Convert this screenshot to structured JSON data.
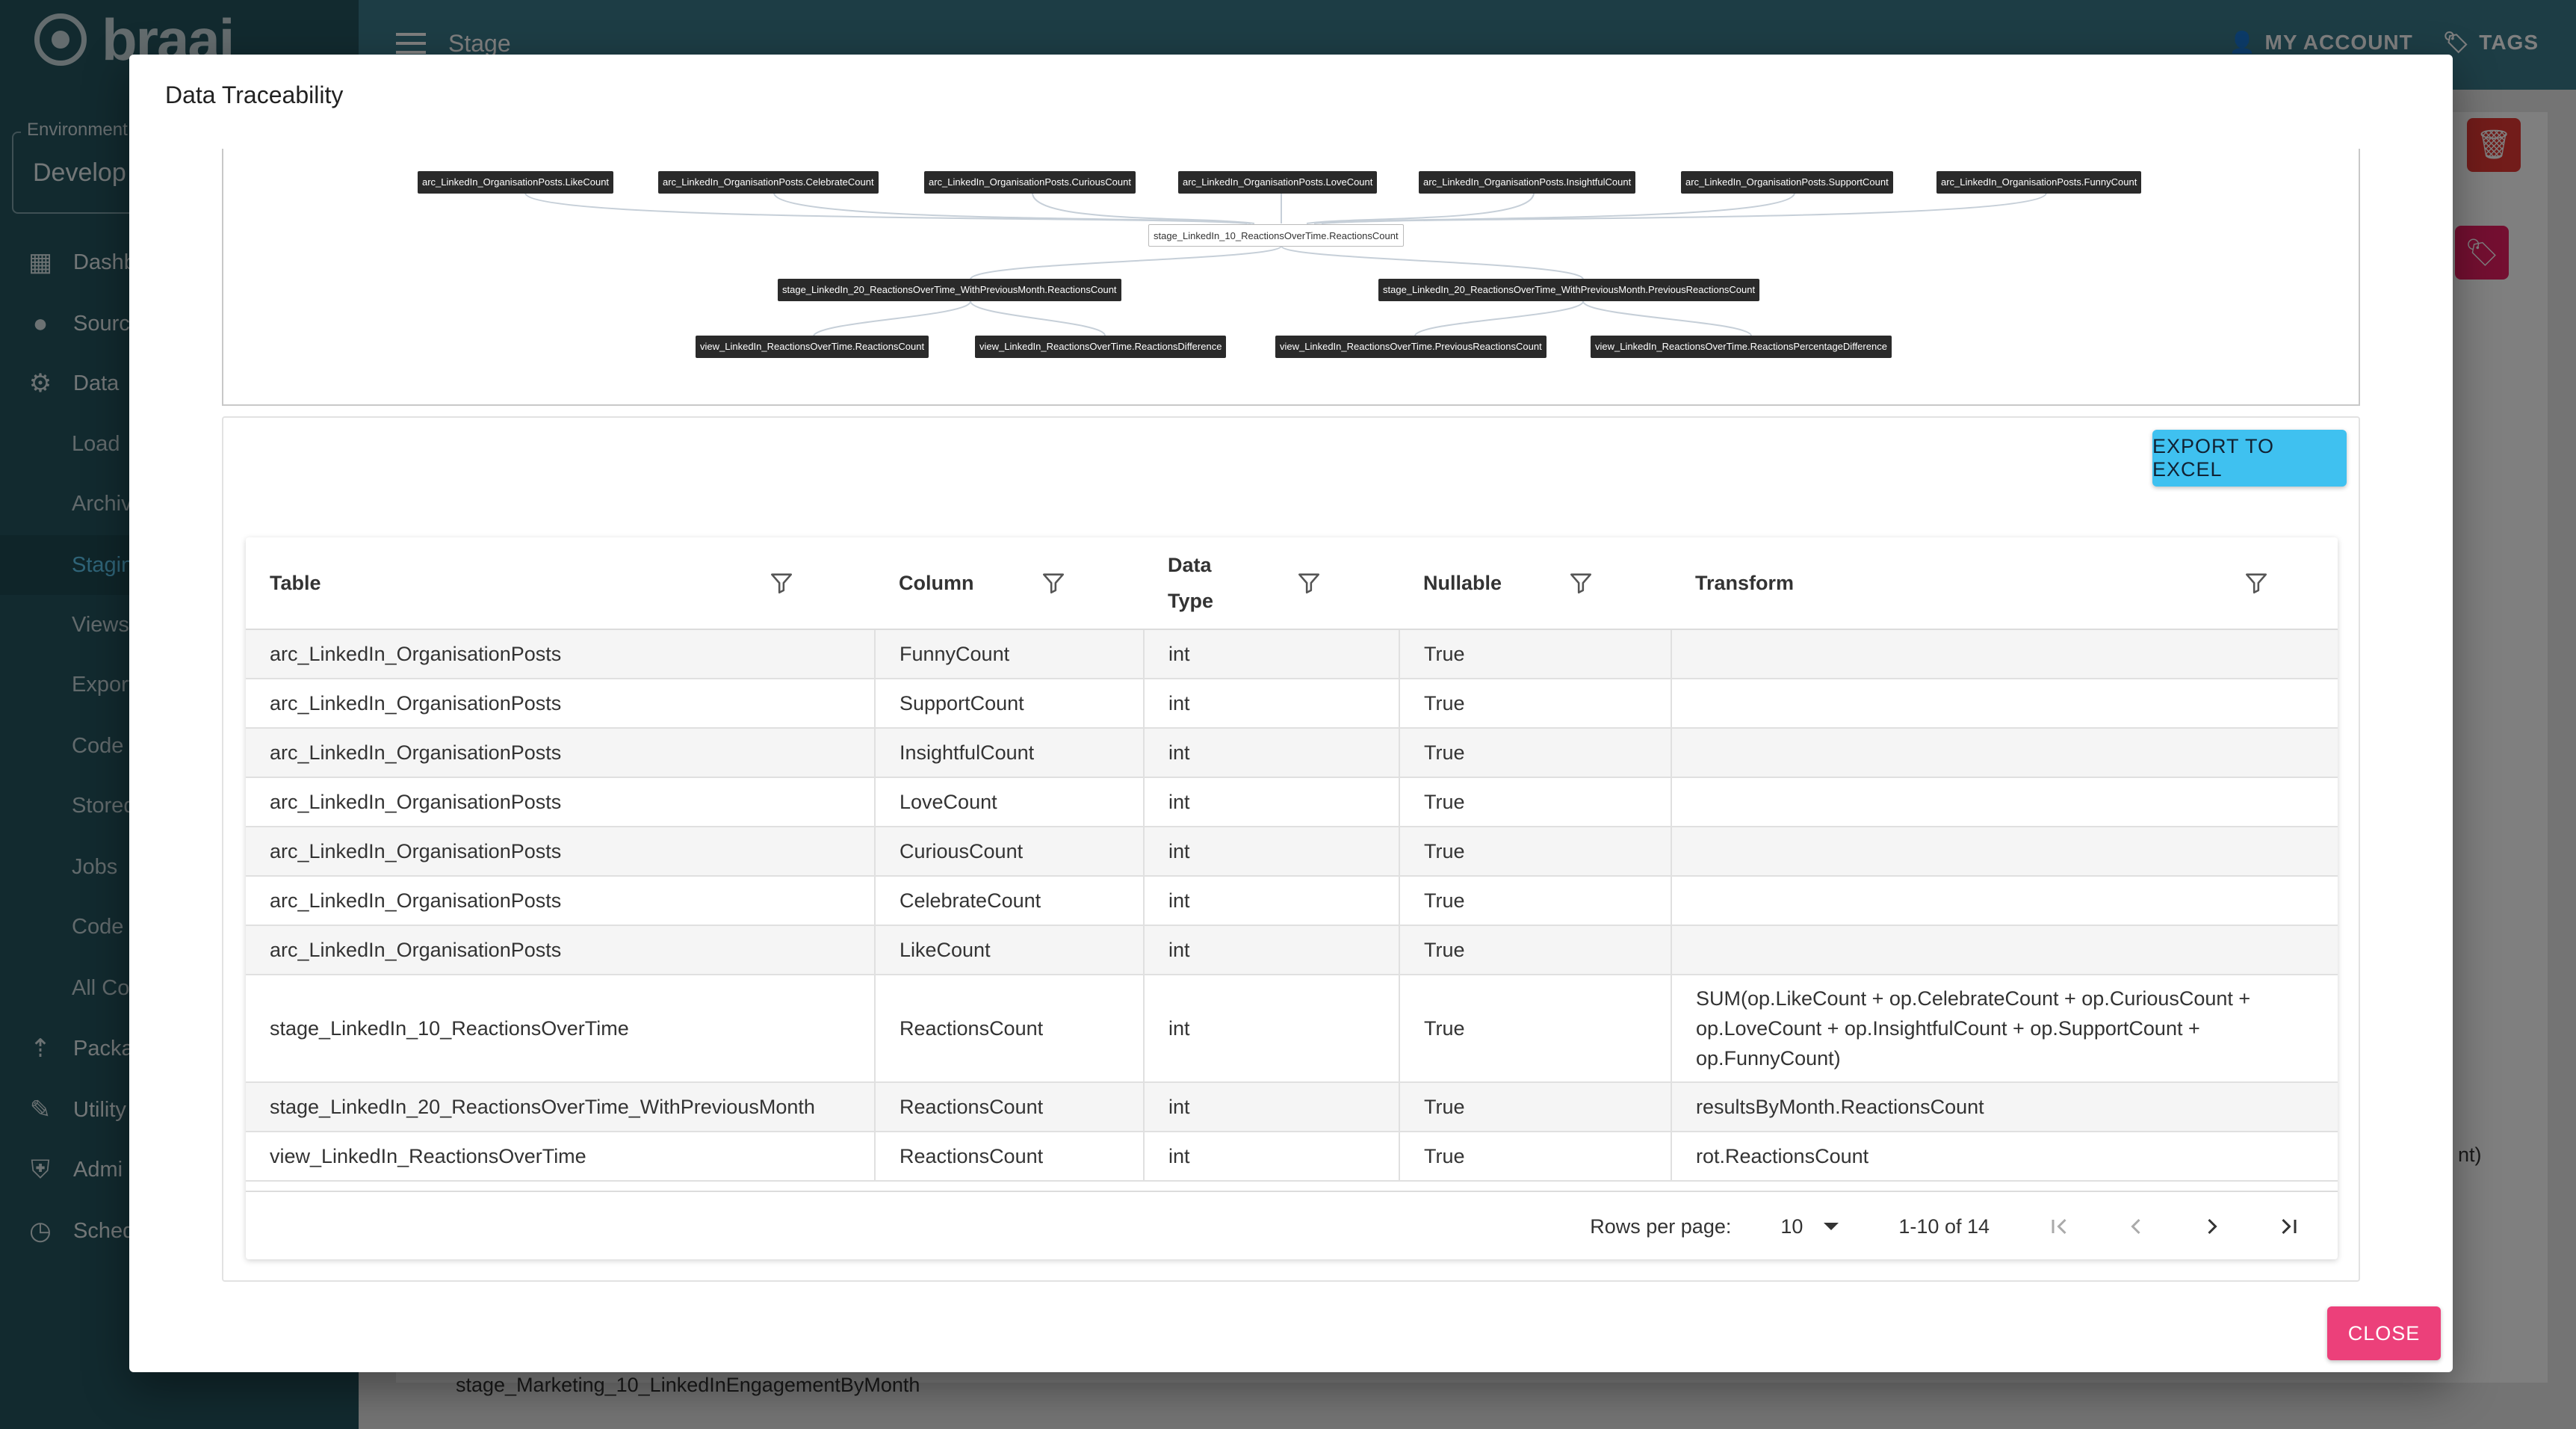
{
  "app": {
    "logo_text": "braai",
    "environment_label": "Environment",
    "environment_value": "Develop",
    "page_title": "Stage",
    "account_label": "MY ACCOUNT",
    "tags_label": "TAGS",
    "nav": [
      {
        "label": "Dashb",
        "icon": "dashboard-icon"
      },
      {
        "label": "Sourc",
        "icon": "wrench-icon"
      },
      {
        "label": "Data",
        "icon": "people-gear-icon"
      }
    ],
    "sub_nav": [
      "Load",
      "Archiv",
      "Stagin",
      "Views",
      "Export",
      "Code",
      "Stored",
      "Jobs",
      "Code I",
      "All Co"
    ],
    "nav_bottom": [
      {
        "label": "Packa",
        "icon": "upload-icon"
      },
      {
        "label": "Utility",
        "icon": "hammer-icon"
      },
      {
        "label": "Admi",
        "icon": "shield-gear-icon"
      },
      {
        "label": "Sched",
        "icon": "clock-icon"
      }
    ],
    "bg_text_fragment": "nt)",
    "bg_bottom_text": "stage_Marketing_10_LinkedInEngagementByMonth"
  },
  "dialog": {
    "title": "Data Traceability",
    "export_label": "EXPORT TO EXCEL",
    "close_label": "CLOSE"
  },
  "graph": {
    "sources": [
      "arc_LinkedIn_OrganisationPosts.LikeCount",
      "arc_LinkedIn_OrganisationPosts.CelebrateCount",
      "arc_LinkedIn_OrganisationPosts.CuriousCount",
      "arc_LinkedIn_OrganisationPosts.LoveCount",
      "arc_LinkedIn_OrganisationPosts.InsightfulCount",
      "arc_LinkedIn_OrganisationPosts.SupportCount",
      "arc_LinkedIn_OrganisationPosts.FunnyCount"
    ],
    "center": "stage_LinkedIn_10_ReactionsOverTime.ReactionsCount",
    "mid": [
      "stage_LinkedIn_20_ReactionsOverTime_WithPreviousMonth.ReactionsCount",
      "stage_LinkedIn_20_ReactionsOverTime_WithPreviousMonth.PreviousReactionsCount"
    ],
    "views": [
      "view_LinkedIn_ReactionsOverTime.ReactionsCount",
      "view_LinkedIn_ReactionsOverTime.ReactionsDifference",
      "view_LinkedIn_ReactionsOverTime.PreviousReactionsCount",
      "view_LinkedIn_ReactionsOverTime.ReactionsPercentageDifference"
    ]
  },
  "table": {
    "headers": {
      "table": "Table",
      "column": "Column",
      "data_type_1": "Data",
      "data_type_2": "Type",
      "nullable": "Nullable",
      "transform": "Transform"
    },
    "rows": [
      {
        "table": "arc_LinkedIn_OrganisationPosts",
        "column": "FunnyCount",
        "type": "int",
        "nullable": "True",
        "transform": ""
      },
      {
        "table": "arc_LinkedIn_OrganisationPosts",
        "column": "SupportCount",
        "type": "int",
        "nullable": "True",
        "transform": ""
      },
      {
        "table": "arc_LinkedIn_OrganisationPosts",
        "column": "InsightfulCount",
        "type": "int",
        "nullable": "True",
        "transform": ""
      },
      {
        "table": "arc_LinkedIn_OrganisationPosts",
        "column": "LoveCount",
        "type": "int",
        "nullable": "True",
        "transform": ""
      },
      {
        "table": "arc_LinkedIn_OrganisationPosts",
        "column": "CuriousCount",
        "type": "int",
        "nullable": "True",
        "transform": ""
      },
      {
        "table": "arc_LinkedIn_OrganisationPosts",
        "column": "CelebrateCount",
        "type": "int",
        "nullable": "True",
        "transform": ""
      },
      {
        "table": "arc_LinkedIn_OrganisationPosts",
        "column": "LikeCount",
        "type": "int",
        "nullable": "True",
        "transform": ""
      },
      {
        "table": "stage_LinkedIn_10_ReactionsOverTime",
        "column": "ReactionsCount",
        "type": "int",
        "nullable": "True",
        "transform": "SUM(op.LikeCount + op.CelebrateCount + op.CuriousCount + op.LoveCount + op.InsightfulCount + op.SupportCount + op.FunnyCount)"
      },
      {
        "table": "stage_LinkedIn_20_ReactionsOverTime_WithPreviousMonth",
        "column": "ReactionsCount",
        "type": "int",
        "nullable": "True",
        "transform": "resultsByMonth.ReactionsCount"
      },
      {
        "table": "view_LinkedIn_ReactionsOverTime",
        "column": "ReactionsCount",
        "type": "int",
        "nullable": "True",
        "transform": "rot.ReactionsCount"
      }
    ],
    "pagination": {
      "rows_per_page_label": "Rows per page:",
      "rows_per_page_value": "10",
      "range": "1-10 of 14"
    }
  }
}
